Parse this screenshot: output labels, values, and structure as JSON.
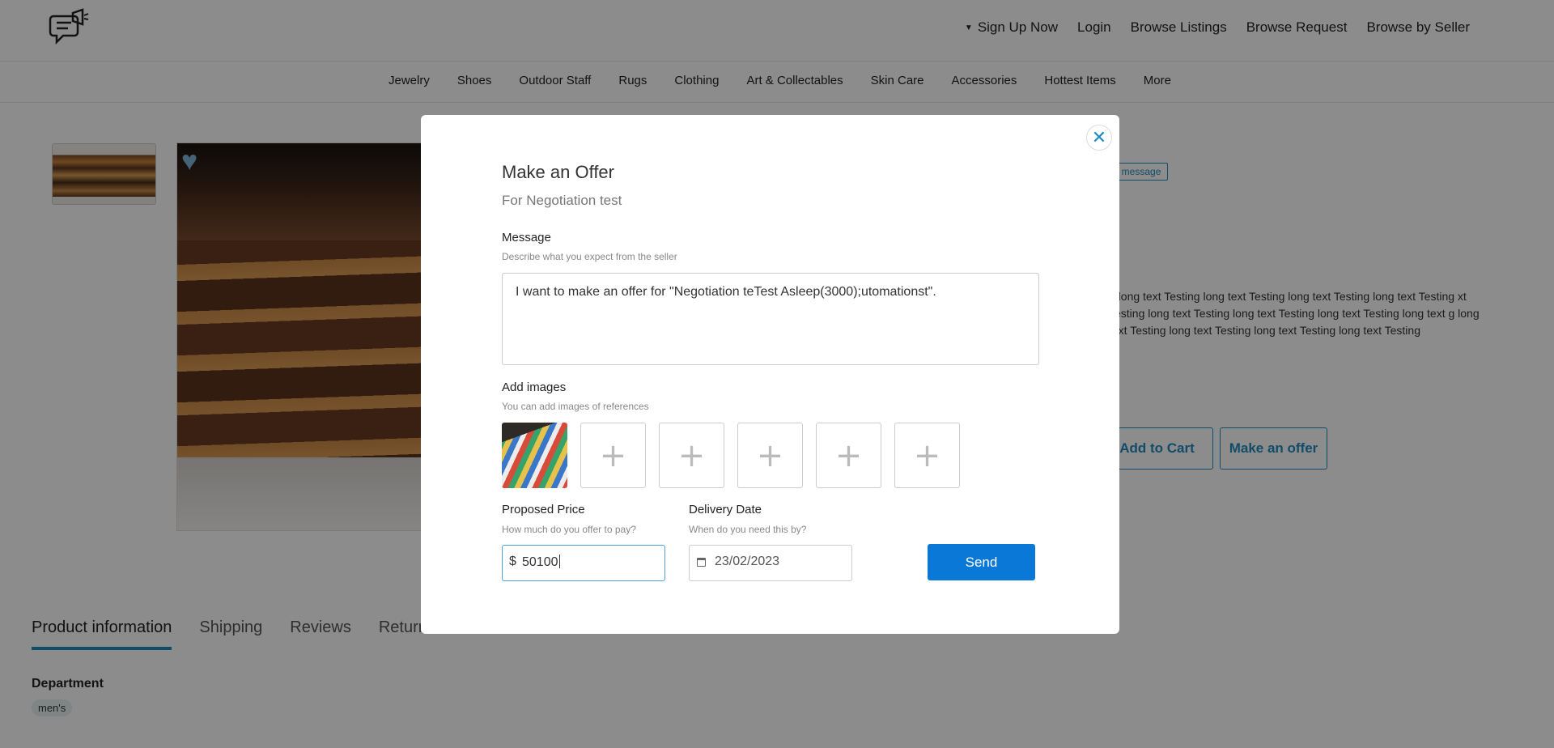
{
  "header": {
    "nav": [
      "Sign Up Now",
      "Login",
      "Browse Listings",
      "Browse Request",
      "Browse by Seller"
    ]
  },
  "categories": [
    "Jewelry",
    "Shoes",
    "Outdoor Staff",
    "Rugs",
    "Clothing",
    "Art & Collectables",
    "Skin Care",
    "Accessories",
    "Hottest Items",
    "More"
  ],
  "product": {
    "send_message": "nd message",
    "description": "g long text Testing long text Testing long text Testing long text Testing xt Testing long text Testing long text Testing long text Testing long text g long text Testing long text Testing long text Testing long text Testing",
    "add_to_cart": "Add to Cart",
    "make_offer": "Make an offer",
    "tabs": [
      "Product information",
      "Shipping",
      "Reviews",
      "Returns & Refunds"
    ],
    "department_label": "Department",
    "department_value": "men's"
  },
  "modal": {
    "title": "Make an Offer",
    "subtitle": "For Negotiation test",
    "message_label": "Message",
    "message_hint": "Describe what you expect from the seller",
    "message_value": "I want to make an offer for \"Negotiation teTest Asleep(3000);utomationst\".",
    "images_label": "Add images",
    "images_hint": "You can add images of references",
    "price_label": "Proposed Price",
    "price_hint": "How much do you offer to pay?",
    "currency": "$",
    "price_value": "50100",
    "date_label": "Delivery Date",
    "date_hint": "When do you need this by?",
    "date_value": "23/02/2023",
    "send_label": "Send"
  }
}
